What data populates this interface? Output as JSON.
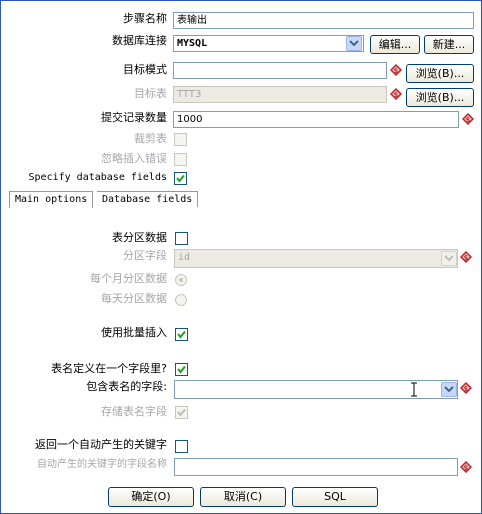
{
  "top": {
    "step_name_label": "步骤名称",
    "step_name_value": "表输出",
    "connection_label": "数据库连接",
    "connection_value": "MYSQL",
    "edit_button": "编辑...",
    "new_button": "新建...",
    "schema_label": "目标模式",
    "schema_value": "",
    "browse_button": "浏览(B)...",
    "table_label": "目标表",
    "table_value": "TTT3",
    "commit_label": "提交记录数量",
    "commit_value": "1000",
    "truncate_label": "裁剪表",
    "ignore_errors_label": "忽略插入错误",
    "specify_fields_label": "Specify database fields"
  },
  "tabs": [
    {
      "label": "Main options"
    },
    {
      "label": "Database fields"
    }
  ],
  "main": {
    "partition_label": "表分区数据",
    "partition_field_label": "分区字段",
    "partition_field_value": "id",
    "monthly_label": "每个月分区数据",
    "daily_label": "每天分区数据",
    "batch_label": "使用批量插入",
    "tablename_in_field_label": "表名定义在一个字段里?",
    "tablename_field_label": "包含表名的字段:",
    "tablename_field_value": "",
    "store_tablename_label": "存储表名字段",
    "return_key_label": "返回一个自动产生的关键字",
    "key_field_label": "自动产生的关键字的字段名称",
    "key_field_value": ""
  },
  "footer": {
    "ok_button": "确定(O)",
    "cancel_button": "取消(C)",
    "sql_button": "SQL"
  },
  "colors": {
    "accent_border": "#2d54b8",
    "variable_icon": "#c02020"
  }
}
